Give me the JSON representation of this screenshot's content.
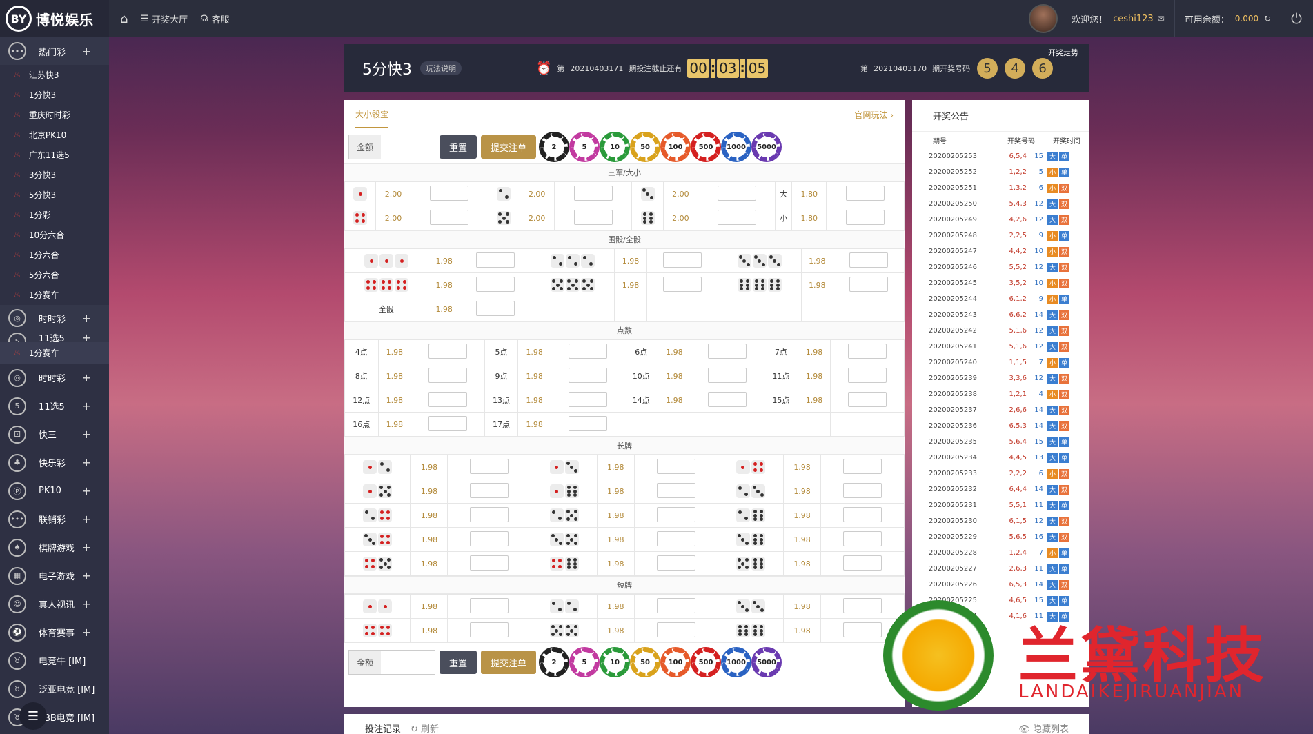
{
  "topbar": {
    "logo_text": "博悦娱乐",
    "nav": [
      {
        "label": "开奖大厅",
        "icon": "list-icon"
      },
      {
        "label": "客服",
        "icon": "headset-icon"
      }
    ],
    "welcome": "欢迎您！",
    "username": "ceshi123",
    "balance_label": "可用余额：",
    "balance": "0.000"
  },
  "sidebar": {
    "top_cat": {
      "label": "热门彩",
      "plus": "+"
    },
    "hot": [
      "江苏快3",
      "1分快3",
      "重庆时时彩",
      "北京PK10",
      "广东11选5",
      "3分快3",
      "5分快3",
      "1分彩",
      "10分六合",
      "1分六合",
      "5分六合",
      "1分赛车"
    ],
    "cut_cats": [
      {
        "label": "时时彩",
        "plus": "+"
      },
      {
        "label": "11选5",
        "plus": "+"
      }
    ],
    "hl_item": "1分赛车",
    "cats": [
      {
        "label": "时时彩",
        "plus": "+"
      },
      {
        "label": "11选5",
        "plus": "+"
      },
      {
        "label": "快三",
        "plus": "+"
      },
      {
        "label": "快乐彩",
        "plus": "+"
      },
      {
        "label": "PK10",
        "plus": "+"
      },
      {
        "label": "联销彩",
        "plus": "+"
      },
      {
        "label": "棋牌游戏",
        "plus": "+"
      },
      {
        "label": "电子游戏",
        "plus": "+"
      },
      {
        "label": "真人视讯",
        "plus": "+"
      },
      {
        "label": "体育赛事",
        "plus": "+"
      },
      {
        "label": "电竞牛 [IM]",
        "plus": ""
      },
      {
        "label": "泛亚电竞 [IM]",
        "plus": ""
      },
      {
        "label": "TBB电竞 [IM]",
        "plus": ""
      }
    ]
  },
  "game": {
    "name": "5分快3",
    "rule": "玩法说明",
    "issue_prefix": "第",
    "cur_issue": "20210403171",
    "countdown_label": "期投注截止还有",
    "countdown": [
      "00",
      "03",
      "05"
    ],
    "last_issue": "20210403170",
    "last_label": "期开奖号码",
    "balls": [
      "5",
      "4",
      "6"
    ],
    "trend": "开奖走势"
  },
  "bet": {
    "tab": "大小骰宝",
    "official": "官网玩法",
    "amount_label": "金额",
    "reset": "重置",
    "submit": "提交注单",
    "chips": [
      "2",
      "5",
      "10",
      "50",
      "100",
      "500",
      "1000",
      "5000"
    ],
    "sections": [
      "三军/大小",
      "围骰/全骰",
      "点数",
      "长牌",
      "短牌"
    ],
    "sanjun": [
      [
        "2.00",
        "2.00",
        "2.00",
        "1.80"
      ],
      [
        "2.00",
        "2.00",
        "2.00",
        "1.80"
      ]
    ],
    "bigsmall": [
      "大",
      "小"
    ],
    "weitou": [
      "1.98",
      "1.98",
      "1.98",
      "1.98",
      "1.98",
      "1.98"
    ],
    "quantou_label": "全骰",
    "quantou": "1.98",
    "points": [
      [
        "4点",
        "1.98",
        "5点",
        "1.98",
        "6点",
        "1.98",
        "7点",
        "1.98"
      ],
      [
        "8点",
        "1.98",
        "9点",
        "1.98",
        "10点",
        "1.98",
        "11点",
        "1.98"
      ],
      [
        "12点",
        "1.98",
        "13点",
        "1.98",
        "14点",
        "1.98",
        "15点",
        "1.98"
      ],
      [
        "16点",
        "1.98",
        "17点",
        "1.98"
      ]
    ],
    "changpai": [
      "1.98",
      "1.98",
      "1.98",
      "1.98",
      "1.98",
      "1.98",
      "1.98",
      "1.98",
      "1.98",
      "1.98",
      "1.98",
      "1.98",
      "1.98",
      "1.98",
      "1.98"
    ],
    "duanpai": [
      "1.98",
      "1.98",
      "1.98",
      "1.98",
      "1.98",
      "1.98"
    ]
  },
  "notice": {
    "title": "开奖公告",
    "headers": [
      "期号",
      "开奖号码",
      "开奖时间"
    ],
    "rows": [
      [
        "20200205253",
        "6,5,4",
        "15",
        "大",
        "单"
      ],
      [
        "20200205252",
        "1,2,2",
        "5",
        "小",
        "单"
      ],
      [
        "20200205251",
        "1,3,2",
        "6",
        "小",
        "双"
      ],
      [
        "20200205250",
        "5,4,3",
        "12",
        "大",
        "双"
      ],
      [
        "20200205249",
        "4,2,6",
        "12",
        "大",
        "双"
      ],
      [
        "20200205248",
        "2,2,5",
        "9",
        "小",
        "单"
      ],
      [
        "20200205247",
        "4,4,2",
        "10",
        "小",
        "双"
      ],
      [
        "20200205246",
        "5,5,2",
        "12",
        "大",
        "双"
      ],
      [
        "20200205245",
        "3,5,2",
        "10",
        "小",
        "双"
      ],
      [
        "20200205244",
        "6,1,2",
        "9",
        "小",
        "单"
      ],
      [
        "20200205243",
        "6,6,2",
        "14",
        "大",
        "双"
      ],
      [
        "20200205242",
        "5,1,6",
        "12",
        "大",
        "双"
      ],
      [
        "20200205241",
        "5,1,6",
        "12",
        "大",
        "双"
      ],
      [
        "20200205240",
        "1,1,5",
        "7",
        "小",
        "单"
      ],
      [
        "20200205239",
        "3,3,6",
        "12",
        "大",
        "双"
      ],
      [
        "20200205238",
        "1,2,1",
        "4",
        "小",
        "双"
      ],
      [
        "20200205237",
        "2,6,6",
        "14",
        "大",
        "双"
      ],
      [
        "20200205236",
        "6,5,3",
        "14",
        "大",
        "双"
      ],
      [
        "20200205235",
        "5,6,4",
        "15",
        "大",
        "单"
      ],
      [
        "20200205234",
        "4,4,5",
        "13",
        "大",
        "单"
      ],
      [
        "20200205233",
        "2,2,2",
        "6",
        "小",
        "双"
      ],
      [
        "20200205232",
        "6,4,4",
        "14",
        "大",
        "双"
      ],
      [
        "20200205231",
        "5,5,1",
        "11",
        "大",
        "单"
      ],
      [
        "20200205230",
        "6,1,5",
        "12",
        "大",
        "双"
      ],
      [
        "20200205229",
        "5,6,5",
        "16",
        "大",
        "双"
      ],
      [
        "20200205228",
        "1,2,4",
        "7",
        "小",
        "单"
      ],
      [
        "20200205227",
        "2,6,3",
        "11",
        "大",
        "单"
      ],
      [
        "20200205226",
        "6,5,3",
        "14",
        "大",
        "双"
      ],
      [
        "20200205225",
        "4,6,5",
        "15",
        "大",
        "单"
      ],
      [
        "20200205224",
        "4,1,6",
        "11",
        "大",
        "单"
      ]
    ]
  },
  "records": {
    "title": "投注记录",
    "refresh": "刷新",
    "hide": "隐藏列表"
  },
  "watermark": {
    "cn": "兰黛科技",
    "en": "LANDAIKEJIRUANJIAN"
  },
  "colors": {
    "gold": "#c2963e",
    "topbar": "#2b2e3c",
    "sidebar": "#2e3043",
    "chips": [
      "#222222",
      "#c23aa0",
      "#2a9a3a",
      "#d9a21c",
      "#e65a2a",
      "#d42020",
      "#2a62c2",
      "#6a3ab0"
    ]
  }
}
